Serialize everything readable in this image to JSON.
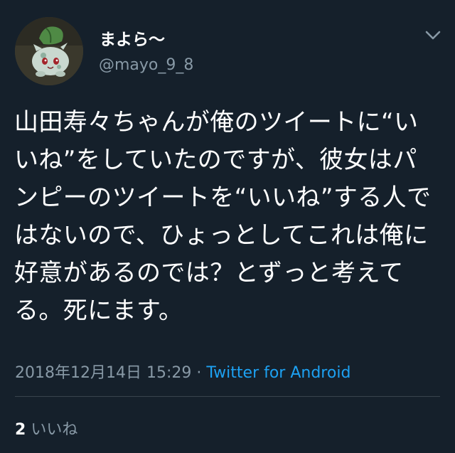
{
  "user": {
    "display_name": "まよら〜",
    "handle": "@mayo_9_8",
    "avatar": "bulbasaur-plush-avatar"
  },
  "tweet": {
    "text": "山田寿々ちゃんが俺のツイートに“いいね”をしていたのですが、彼女はパンピーのツイートを“いいね”する人ではないので、ひょっとしてこれは俺に好意があるのでは？とずっと考えてる。死にます。",
    "date": "2018年12月14日 15:29",
    "separator": "·",
    "source": "Twitter for Android"
  },
  "stats": {
    "likes_count": "2",
    "likes_label": "いいね"
  },
  "icons": {
    "menu": "chevron-down-icon"
  },
  "colors": {
    "background": "#15202b",
    "primary_text": "#ffffff",
    "secondary_text": "#8899a6",
    "link": "#1da1f2",
    "divider": "#38444d"
  }
}
